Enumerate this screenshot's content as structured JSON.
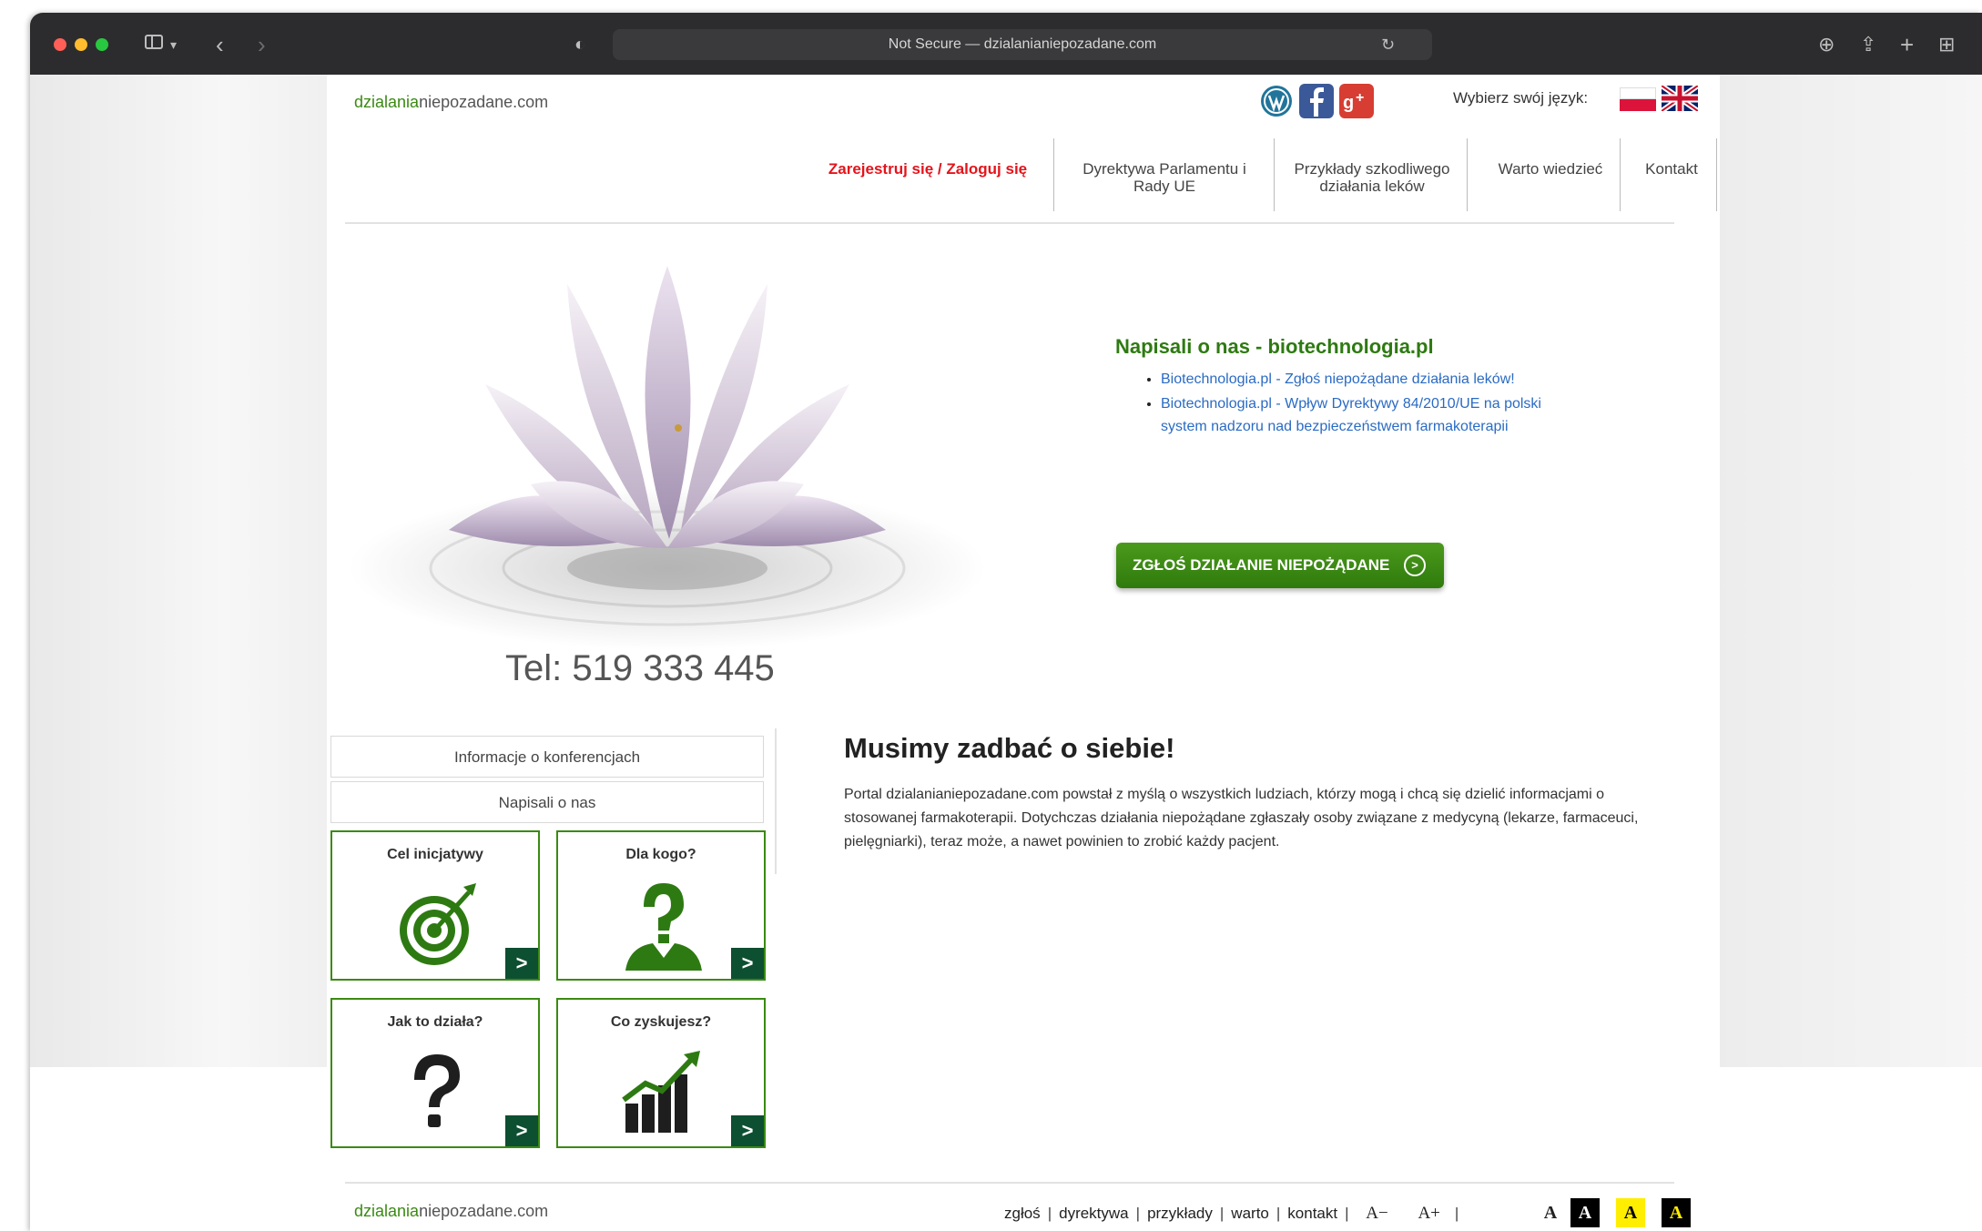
{
  "browser": {
    "address": "Not Secure — dzialanianiepozadane.com",
    "sidebar_toggle": "sidebar-icon",
    "reload_icon": "reload-icon"
  },
  "site": {
    "brand_green": "dzialania",
    "brand_gray": "niepozadane.com",
    "language_label": "Wybierz swój język:",
    "colors": {
      "brand_green": "#3a8a12",
      "register_red": "#e4141b",
      "tile_arrow": "#0d4f31"
    }
  },
  "nav": {
    "register": "Zarejestruj się / Zaloguj się",
    "items": [
      "Dyrektywa Parlamentu i Rady UE",
      "Przykłady szkodliwego działania leków",
      "Warto wiedzieć",
      "Kontakt"
    ]
  },
  "hero": {
    "tel": "Tel: 519 333 445"
  },
  "news": {
    "title": "Napisali o nas - biotechnologia.pl",
    "items": [
      "Biotechnologia.pl - Zgłoś niepożądane działania leków!",
      "Biotechnologia.pl - Wpływ Dyrektywy 84/2010/UE na polski system nadzoru nad bezpieczeństwem farmakoterapii"
    ]
  },
  "cta": {
    "label": "ZGŁOŚ DZIAŁANIE NIEPOŻĄDANE"
  },
  "sidebar_menu": [
    "Informacje o konferencjach",
    "Napisali o nas"
  ],
  "tiles": [
    {
      "title": "Cel inicjatywy",
      "icon": "target-icon",
      "arrow": ">"
    },
    {
      "title": "Dla kogo?",
      "icon": "person-question-icon",
      "arrow": ">"
    },
    {
      "title": "Jak to działa?",
      "icon": "question-mark-icon",
      "arrow": ">"
    },
    {
      "title": "Co zyskujesz?",
      "icon": "growth-chart-icon",
      "arrow": ">"
    }
  ],
  "main": {
    "heading": "Musimy zadbać o siebie!",
    "text": "Portal dzialanianiepozadane.com powstał z myślą o wszystkich ludziach, którzy mogą i chcą się dzielić informacjami o stosowanej farmakoterapii. Dotychczas działania niepożądane zgłaszały osoby związane z medycyną (lekarze, farmaceuci, pielęgniarki), teraz może, a nawet powinien to zrobić każdy pacjent."
  },
  "footer": {
    "links": [
      "zgłoś",
      "dyrektywa",
      "przykłady",
      "warto",
      "kontakt"
    ],
    "font_minus": "A−",
    "font_plus": "A+",
    "contrast": [
      "A",
      "A",
      "A",
      "A"
    ]
  }
}
